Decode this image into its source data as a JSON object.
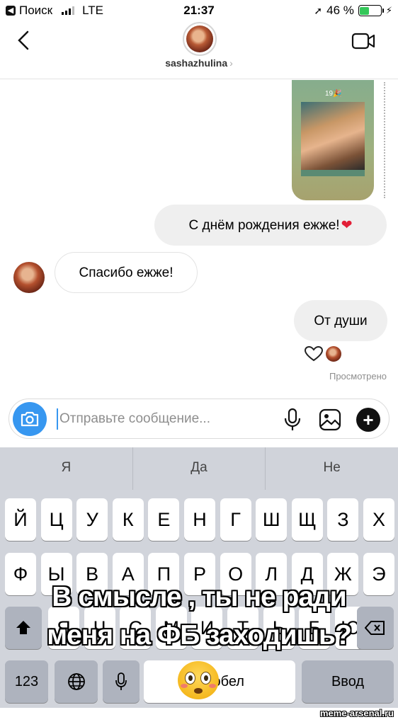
{
  "status": {
    "back_app": "Поиск",
    "network": "LTE",
    "time": "21:37",
    "battery": "46 %",
    "battery_level": 0.46
  },
  "header": {
    "username": "sashazhulina",
    "chevron": "›"
  },
  "media": {
    "tag": "19🎉"
  },
  "messages": [
    {
      "side": "out",
      "text": "С днём рождения ежже!",
      "emoji": "❤️"
    },
    {
      "side": "in",
      "text": "Спасибо ежже!"
    },
    {
      "side": "out",
      "text": "От души"
    }
  ],
  "seen_label": "Просмотрено",
  "composer": {
    "placeholder": "Отправьте сообщение..."
  },
  "keyboard": {
    "suggestions": [
      "Я",
      "Да",
      "Не"
    ],
    "row1": [
      "Й",
      "Ц",
      "У",
      "К",
      "Е",
      "Н",
      "Г",
      "Ш",
      "Щ",
      "З",
      "Х"
    ],
    "row2": [
      "Ф",
      "Ы",
      "В",
      "А",
      "П",
      "Р",
      "О",
      "Л",
      "Д",
      "Ж",
      "Э"
    ],
    "row3": [
      "Я",
      "Ч",
      "С",
      "М",
      "И",
      "Т",
      "Ь",
      "Б",
      "Ю"
    ],
    "numbers_key": "123",
    "space_key": "Пробел",
    "return_key": "Ввод"
  },
  "meme": {
    "line1": "В смысле , ты не ради",
    "line2": "меня на ФБ заходишь?"
  },
  "watermark": "meme-arsenal.ru",
  "colors": {
    "accent": "#3797f0",
    "heart": "#e21f37",
    "battery": "#34c759"
  }
}
